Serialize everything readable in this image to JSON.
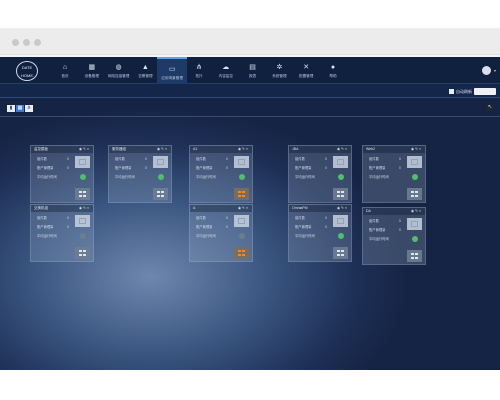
{
  "logo_text": "DATE HOME",
  "nav": {
    "items": [
      {
        "label": "首页",
        "icon": "home-icon",
        "glyph": "⌂"
      },
      {
        "label": "设备管理",
        "icon": "grid-icon",
        "glyph": "▦"
      },
      {
        "label": "网络连接管理",
        "icon": "globe-icon",
        "glyph": "◍"
      },
      {
        "label": "告警管理",
        "icon": "warning-icon",
        "glyph": "▲"
      },
      {
        "label": "应用场景管理",
        "icon": "monitor-icon",
        "glyph": "▭"
      },
      {
        "label": "拓扑",
        "icon": "topology-icon",
        "glyph": "⋔"
      },
      {
        "label": "内容监控",
        "icon": "cloud-icon",
        "glyph": "☁"
      },
      {
        "label": "报表",
        "icon": "document-icon",
        "glyph": "▤"
      },
      {
        "label": "系统管理",
        "icon": "gear-icon",
        "glyph": "✲"
      },
      {
        "label": "配置管理",
        "icon": "tools-icon",
        "glyph": "✕"
      },
      {
        "label": "帮助",
        "icon": "info-icon",
        "glyph": "●"
      }
    ],
    "active_index": 4
  },
  "subbar": {
    "auto_refresh_label": "自动刷新",
    "auto_refresh_checked": true
  },
  "toolbar": {
    "buttons": [
      {
        "icon": "chart-icon",
        "glyph": "▮"
      },
      {
        "icon": "grid-view-icon",
        "glyph": "▦"
      },
      {
        "icon": "topology-view-icon",
        "glyph": "⋔"
      }
    ],
    "active_index": 1
  },
  "cards": [
    {
      "name": "监控模板",
      "rows": [
        {
          "label": "组件数",
          "value": "0"
        },
        {
          "label": "账户管理量",
          "value": "0"
        },
        {
          "label": "平均运行时间",
          "value": ""
        }
      ],
      "status": "green",
      "grid": "grey"
    },
    {
      "name": "服务器组",
      "rows": [
        {
          "label": "组件数",
          "value": "0"
        },
        {
          "label": "账户管理量",
          "value": "0"
        },
        {
          "label": "平均运行时间",
          "value": ""
        }
      ],
      "status": "green",
      "grid": "grey"
    },
    {
      "name": "A1",
      "rows": [
        {
          "label": "组件数",
          "value": "0"
        },
        {
          "label": "账户管理量",
          "value": "0"
        },
        {
          "label": "平均运行时间",
          "value": ""
        }
      ],
      "status": "green",
      "grid": "orange"
    },
    {
      "name": "JBA",
      "rows": [
        {
          "label": "组件数",
          "value": "0"
        },
        {
          "label": "账户管理量",
          "value": "0"
        },
        {
          "label": "平均运行时间",
          "value": ""
        }
      ],
      "status": "green",
      "grid": "grey"
    },
    {
      "name": "Web2",
      "rows": [
        {
          "label": "组件数",
          "value": "0"
        },
        {
          "label": "账户管理量",
          "value": "0"
        },
        {
          "label": "平均运行时间",
          "value": ""
        }
      ],
      "status": "green",
      "grid": "grey"
    },
    {
      "name": "交换机组",
      "rows": [
        {
          "label": "组件数",
          "value": "0"
        },
        {
          "label": "账户管理量",
          "value": "0"
        },
        {
          "label": "平均运行时间",
          "value": ""
        }
      ],
      "status": "grey",
      "grid": "grey"
    },
    {
      "name": "A",
      "rows": [
        {
          "label": "组件数",
          "value": "0"
        },
        {
          "label": "账户管理量",
          "value": "0"
        },
        {
          "label": "平均运行时间",
          "value": ""
        }
      ],
      "status": "grey",
      "grid": "orange"
    },
    {
      "name": "OmniaPM",
      "rows": [
        {
          "label": "组件数",
          "value": "0"
        },
        {
          "label": "账户管理量",
          "value": "0"
        },
        {
          "label": "平均运行时间",
          "value": ""
        }
      ],
      "status": "green",
      "grid": "grey"
    },
    {
      "name": "DA",
      "rows": [
        {
          "label": "组件数",
          "value": "0"
        },
        {
          "label": "账户管理量",
          "value": "0"
        },
        {
          "label": "平均运行时间",
          "value": ""
        }
      ],
      "status": "green",
      "grid": "grey"
    }
  ],
  "card_actions": [
    "eye-icon",
    "edit-icon",
    "close-icon"
  ],
  "colors": {
    "status_green": "#4fc06a",
    "accent_orange": "#f08a24",
    "nav_bg": "#10203f"
  }
}
